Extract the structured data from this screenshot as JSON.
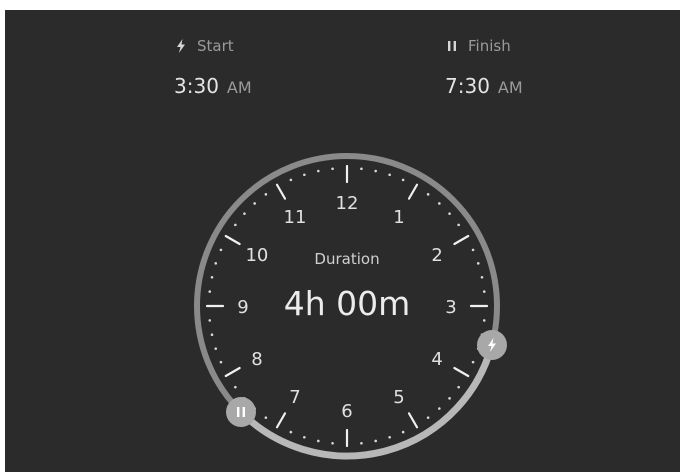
{
  "start": {
    "label": "Start",
    "icon": "lightning-icon",
    "time": "3:30",
    "period": "AM"
  },
  "finish": {
    "label": "Finish",
    "icon": "pause-icon",
    "time": "7:30",
    "period": "AM"
  },
  "clock": {
    "duration_label": "Duration",
    "duration_value": "4h 00m",
    "hour_labels": [
      "12",
      "1",
      "2",
      "3",
      "4",
      "5",
      "6",
      "7",
      "8",
      "9",
      "10",
      "11"
    ],
    "start_handle_icon": "lightning-icon",
    "finish_handle_icon": "pause-icon"
  },
  "colors": {
    "background": "#2b2b2b",
    "ring": "#8a8a8a",
    "arc": "#b8b8b8",
    "handle": "#a8a8a8",
    "text": "#e4e4e4",
    "muted_text": "#9a9a9a"
  }
}
